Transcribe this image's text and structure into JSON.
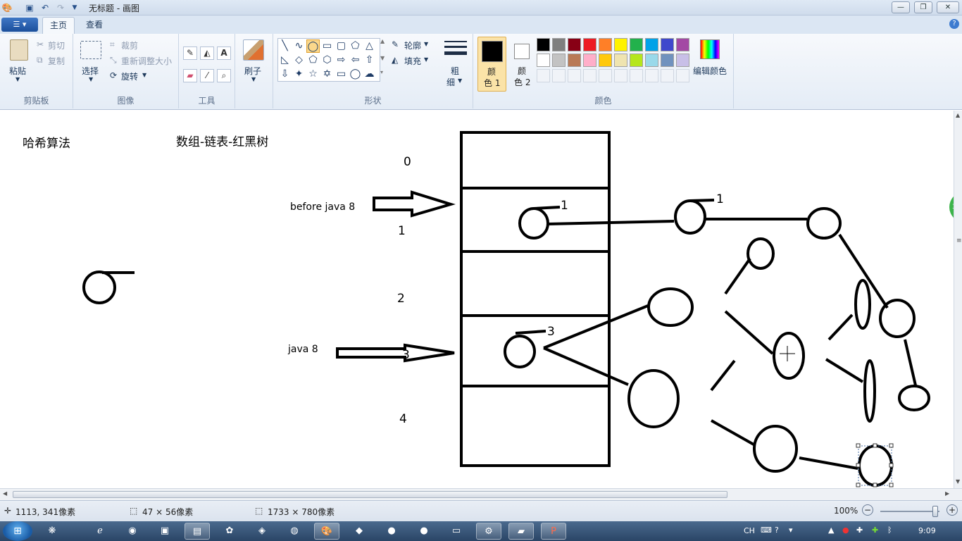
{
  "window": {
    "title": "无标题 - 画图",
    "controls": {
      "minimize": "—",
      "maximize": "❐",
      "close": "✕"
    }
  },
  "ribbon_tabs": {
    "home": "主页",
    "view": "查看"
  },
  "ribbon": {
    "clipboard": {
      "label": "剪贴板",
      "paste": "粘贴",
      "cut": "剪切",
      "copy": "复制"
    },
    "image": {
      "label": "图像",
      "select": "选择",
      "crop": "裁剪",
      "resize": "重新调整大小",
      "rotate": "旋转"
    },
    "tools": {
      "label": "工具"
    },
    "brushes": {
      "label": "刷子"
    },
    "shapes": {
      "label": "形状",
      "outline": "轮廓",
      "fill": "填充"
    },
    "size": {
      "label_line1": "粗",
      "label_line2": "细"
    },
    "colors": {
      "label": "颜色",
      "color1_line1": "颜",
      "color1_line2": "色 1",
      "color2_line1": "颜",
      "color2_line2": "色 2",
      "edit": "编辑颜色",
      "color1_value": "#000000",
      "color2_value": "#ffffff",
      "palette_row1": [
        "#000000",
        "#7f7f7f",
        "#880015",
        "#ed1c24",
        "#ff7f27",
        "#fff200",
        "#22b14c",
        "#00a2e8",
        "#3f48cc",
        "#a349a4"
      ],
      "palette_row2": [
        "#ffffff",
        "#c3c3c3",
        "#b97a57",
        "#ffaec9",
        "#ffc90e",
        "#efe4b0",
        "#b5e61d",
        "#99d9ea",
        "#7092be",
        "#c8bfe7"
      ]
    }
  },
  "canvas": {
    "text_hash_algorithm": "哈希算法",
    "text_structures": "数组-链表-红黑树",
    "text_before_java8": "before java 8",
    "text_java8": "java 8",
    "index_0": "0",
    "index_1": "1",
    "index_2": "2",
    "index_3": "3",
    "index_4": "4",
    "node_label_1a": "1",
    "node_label_1b": "1",
    "node_label_3": "3"
  },
  "statusbar": {
    "cursor_pos": "1113, 341像素",
    "selection_size": "47 × 56像素",
    "image_size": "1733 × 780像素",
    "zoom": "100%",
    "zoom_level": 1.0
  },
  "taskbar": {
    "lang": "CH",
    "time": "9:09"
  }
}
